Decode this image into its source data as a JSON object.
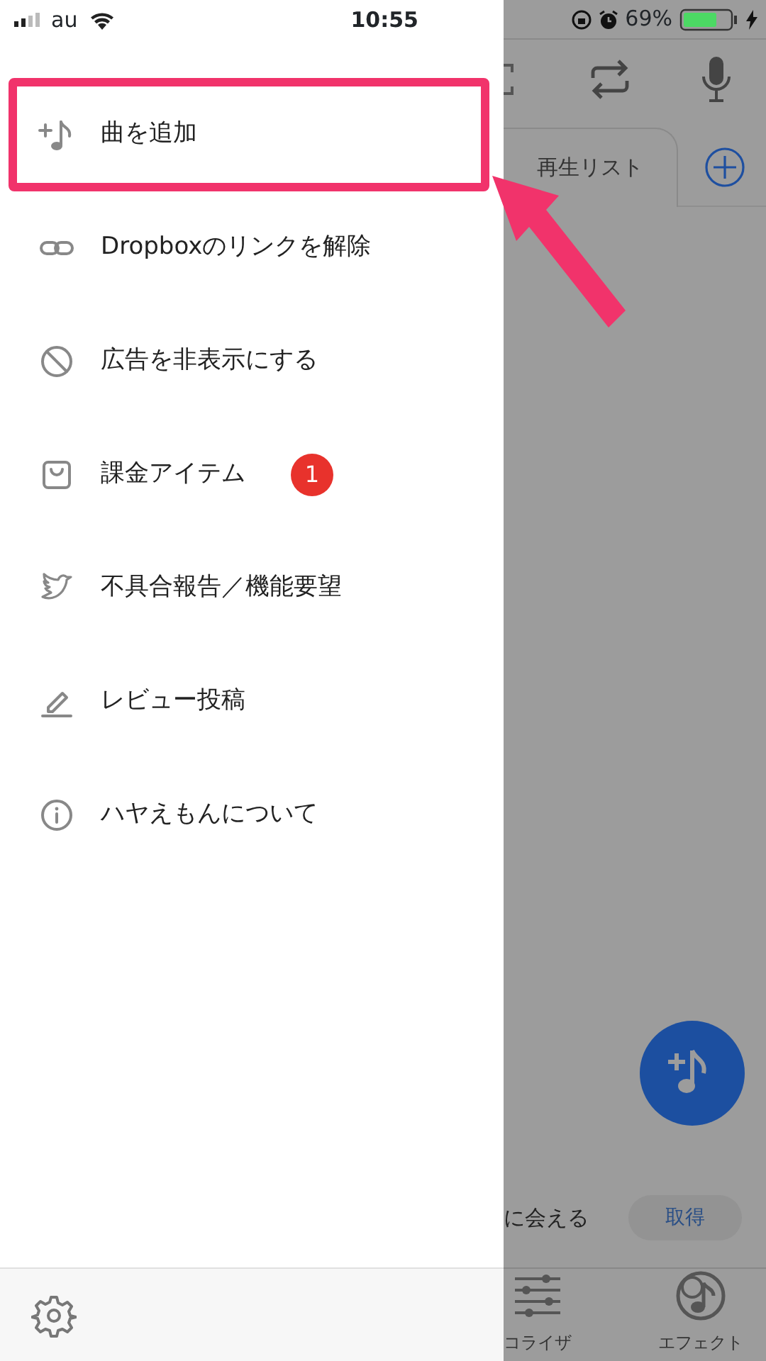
{
  "status_bar": {
    "carrier": "au",
    "time": "10:55",
    "battery": "69%"
  },
  "drawer": {
    "items": [
      {
        "label": "曲を追加",
        "highlighted": true
      },
      {
        "label": "Dropboxのリンクを解除",
        "highlighted": false
      },
      {
        "label": "広告を非表示にする",
        "highlighted": false
      },
      {
        "label": "課金アイテム",
        "badge": "1",
        "highlighted": false
      },
      {
        "label": "不具合報告／機能要望",
        "highlighted": false
      },
      {
        "label": "レビュー投稿",
        "highlighted": false
      },
      {
        "label": "ハヤえもんについて",
        "highlighted": false
      }
    ]
  },
  "background": {
    "tab": "再生リスト",
    "banner_text": "に会える",
    "banner_button": "取得",
    "bottom_nav": [
      {
        "label": "コライザ"
      },
      {
        "label": "エフェクト"
      }
    ]
  }
}
